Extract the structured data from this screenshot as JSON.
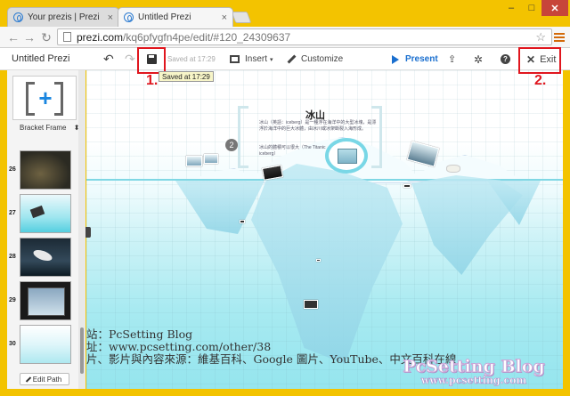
{
  "browser": {
    "tabs": [
      {
        "title": "Your prezis | Prezi"
      },
      {
        "title": "Untitled Prezi"
      }
    ],
    "window_controls": {
      "minimize": "–",
      "maximize": "□",
      "close": "✕"
    },
    "url_host": "prezi.com",
    "url_path": "/kq6pfygfn4pe/edit/#120_24309637"
  },
  "toolbar": {
    "title": "Untitled Prezi",
    "saved_label": "Saved at 17:29",
    "insert_label": "Insert",
    "customize_label": "Customize",
    "present_label": "Present",
    "exit_label": "Exit"
  },
  "annotations": {
    "tooltip": "Saved at 17:29",
    "step1": "1.",
    "step2": "2."
  },
  "sidebar": {
    "frame_select": "Bracket Frame",
    "slides": [
      {
        "number": "26"
      },
      {
        "number": "27"
      },
      {
        "number": "28"
      },
      {
        "number": "29"
      },
      {
        "number": "30"
      }
    ],
    "edit_path_label": "Edit Path"
  },
  "canvas": {
    "title": "冰山",
    "para1": "冰山（英語：iceberg）是一種浮在海洋中的大型冰塊，是漂浮於海洋中的巨大冰體，由冰川或冰架斷裂入海形成。",
    "para2": "冰山的體積可以很大（The Titanic iceberg）",
    "path_number": "2",
    "footer_lines": [
      "站：PcSetting Blog",
      "址：www.pcsetting.com/other/38",
      "片、影片與內容來源：維基百科、Google 圖片、YouTube、中文百科在線"
    ],
    "watermark_title": "PcSetting Blog",
    "watermark_url": "www.pcsetting.com"
  },
  "colors": {
    "highlight": "#e0161e",
    "present_blue": "#1a6fcf",
    "window_bg": "#f3c300"
  }
}
